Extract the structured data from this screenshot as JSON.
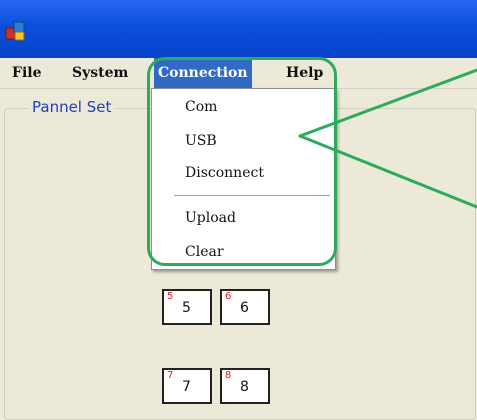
{
  "menu": {
    "file": "File",
    "system": "System",
    "connection": "Connection",
    "help": "Help"
  },
  "groupbox": {
    "legend": "Pannel Set"
  },
  "dropdown": {
    "items": [
      "Com",
      "USB",
      "Disconnect",
      "Upload",
      "Clear"
    ]
  },
  "pannels": [
    {
      "small": "5",
      "big": "5"
    },
    {
      "small": "6",
      "big": "6"
    },
    {
      "small": "7",
      "big": "7"
    },
    {
      "small": "8",
      "big": "8"
    }
  ],
  "colors": {
    "titlebar": "#0a4fdc",
    "menu_active": "#316ac5",
    "highlight": "#2cab5a",
    "legend": "#1f3fbf",
    "pannel_number": "#e02020"
  },
  "icons": {
    "app": "app-icon",
    "arrow": "annotation-arrow"
  }
}
